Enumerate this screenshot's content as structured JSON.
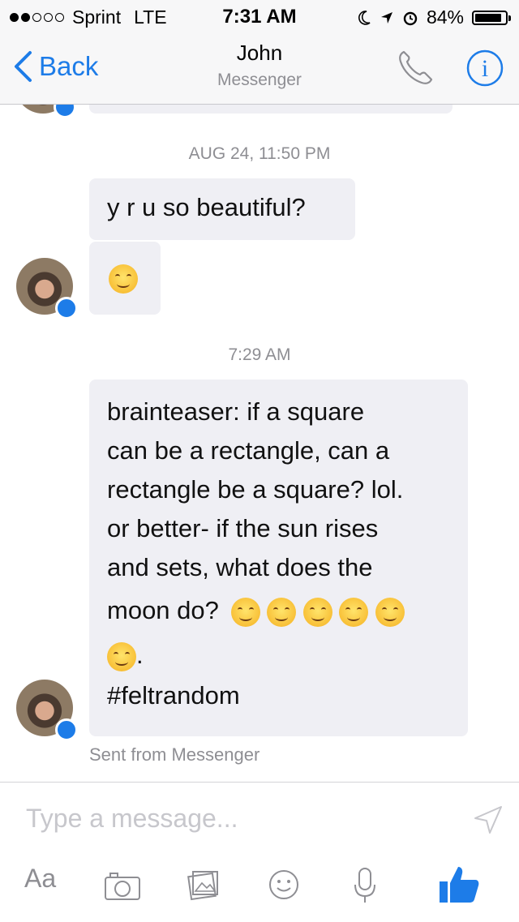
{
  "status_bar": {
    "carrier": "Sprint",
    "network": "LTE",
    "time": "7:31 AM",
    "battery": "84%",
    "signal_bars_filled": 2,
    "signal_bars_total": 5
  },
  "nav": {
    "back_label": "Back",
    "contact_name": "John",
    "subtitle": "Messenger"
  },
  "messages": {
    "timestamp1": "AUG 24, 11:50 PM",
    "msg1": "y r u so beautiful?",
    "timestamp2": "7:29 AM",
    "msg3_line1": "brainteaser: if a square",
    "msg3_line2": "can be a rectangle, can a",
    "msg3_line3": "rectangle be a square? lol.",
    "msg3_line4": "or better- if the sun rises",
    "msg3_line5": "and sets, what does the",
    "msg3_line6": "moon do?",
    "msg3_line8": "#feltrandom",
    "sent_from": "Sent from Messenger"
  },
  "composer": {
    "placeholder": "Type a message...",
    "aa_label": "Aa"
  },
  "colors": {
    "accent": "#1d7ce8",
    "bubble": "#efeff4",
    "muted": "#8e8e93"
  }
}
